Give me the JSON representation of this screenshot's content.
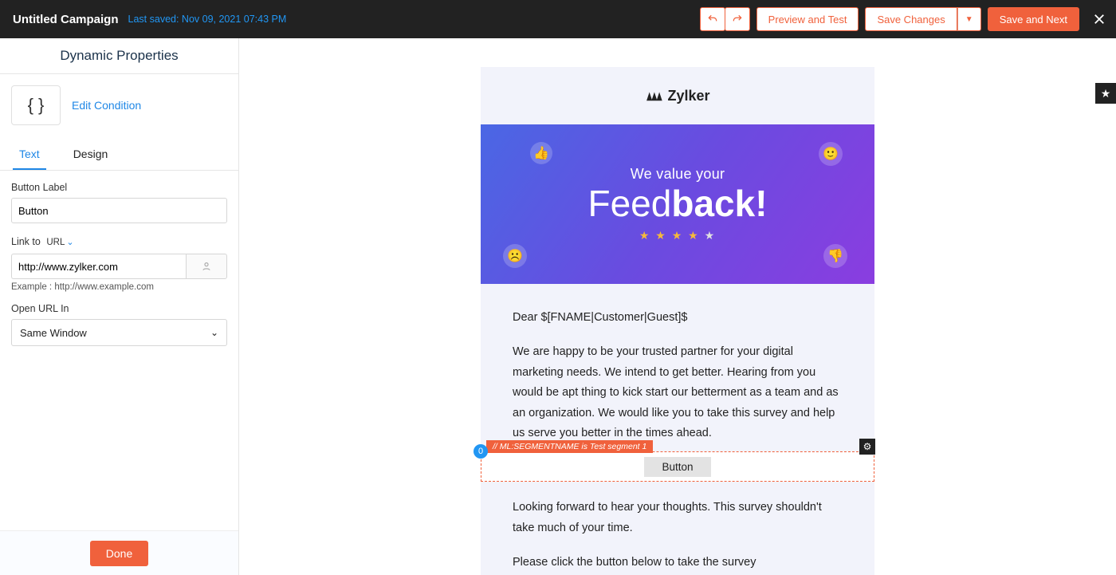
{
  "topbar": {
    "title": "Untitled Campaign",
    "saved_text": "Last saved: Nov 09, 2021 07:43 PM",
    "preview_label": "Preview and Test",
    "save_changes_label": "Save Changes",
    "save_next_label": "Save and Next"
  },
  "sidebar": {
    "header": "Dynamic Properties",
    "cond_icon": "{ }",
    "edit_condition": "Edit Condition",
    "tabs": {
      "text": "Text",
      "design": "Design"
    },
    "button_label": {
      "label": "Button Label",
      "value": "Button"
    },
    "link_to": {
      "label": "Link to",
      "chip": "URL",
      "value": "http://www.zylker.com",
      "example": "Example : http://www.example.com"
    },
    "open_url_in": {
      "label": "Open URL In",
      "value": "Same Window"
    },
    "done": "Done"
  },
  "email": {
    "brand": "Zylker",
    "hero_small": "We value your",
    "hero_big_light": "Feed",
    "hero_big_bold": "back!",
    "greeting": "Dear $[FNAME|Customer|Guest]$",
    "para1": "We are happy to be your trusted partner for your digital marketing needs. We intend to get better. Hearing from you would be apt thing to kick start our betterment as a team and as an organization. We would like you to take this survey and help us serve you better in the times ahead.",
    "segment_tag": "// ML:SEGMENTNAME is Test segment 1",
    "segment_button": "Button",
    "para2": "Looking forward to hear your thoughts. This survey shouldn't take much of your time.",
    "para3": "Please click the button below to take the survey",
    "drag_badge": "0"
  }
}
